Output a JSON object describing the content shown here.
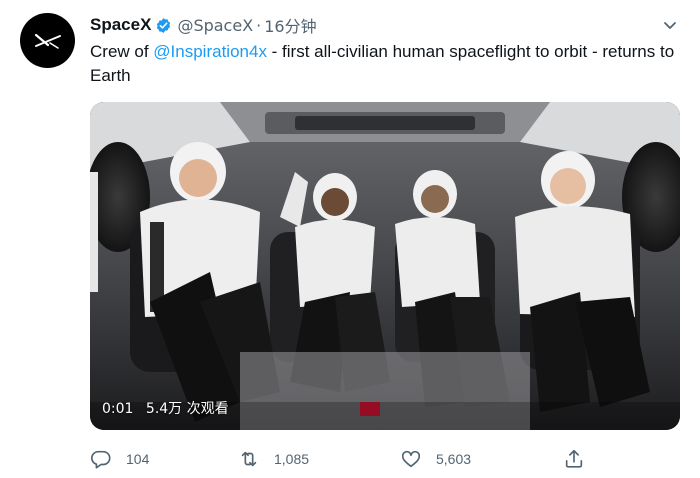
{
  "tweet": {
    "author_name": "SpaceX",
    "handle": "@SpaceX",
    "separator": "·",
    "time": "16分钟",
    "text_prefix": "Crew of ",
    "mention": "@Inspiration4x",
    "text_suffix": " - first all-civilian human spaceflight to orbit - returns to Earth"
  },
  "video": {
    "duration": "0:01",
    "views": "5.4万 次观看"
  },
  "actions": {
    "reply_count": "104",
    "retweet_count": "1,085",
    "like_count": "5,603"
  },
  "colors": {
    "accent": "#1d9bf0",
    "muted": "#536471",
    "text": "#0f1419"
  },
  "icons": [
    "spacex-logo-icon",
    "verified-badge-icon",
    "caret-down-icon",
    "reply-icon",
    "retweet-icon",
    "like-icon",
    "share-icon"
  ]
}
